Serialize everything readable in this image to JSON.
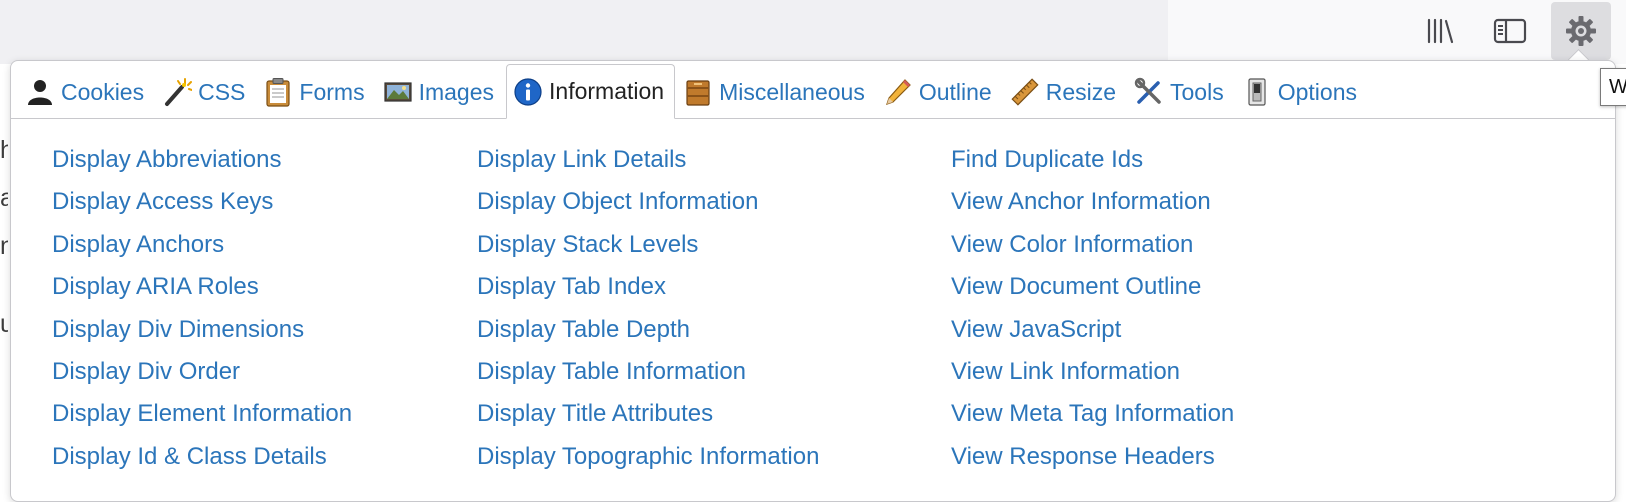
{
  "browser": {
    "tooltip_text": "W"
  },
  "background_letters": [
    "h",
    "a",
    "n",
    "u"
  ],
  "tabs": [
    {
      "label": "Cookies",
      "icon": "person-silhouette-icon"
    },
    {
      "label": "CSS",
      "icon": "magic-wand-icon"
    },
    {
      "label": "Forms",
      "icon": "clipboard-icon"
    },
    {
      "label": "Images",
      "icon": "picture-icon"
    },
    {
      "label": "Information",
      "icon": "info-icon",
      "active": true
    },
    {
      "label": "Miscellaneous",
      "icon": "box-icon"
    },
    {
      "label": "Outline",
      "icon": "pencil-icon"
    },
    {
      "label": "Resize",
      "icon": "ruler-icon"
    },
    {
      "label": "Tools",
      "icon": "wrench-screwdriver-icon"
    },
    {
      "label": "Options",
      "icon": "switch-icon"
    }
  ],
  "columns": [
    [
      "Display Abbreviations",
      "Display Access Keys",
      "Display Anchors",
      "Display ARIA Roles",
      "Display Div Dimensions",
      "Display Div Order",
      "Display Element Information",
      "Display Id & Class Details"
    ],
    [
      "Display Link Details",
      "Display Object Information",
      "Display Stack Levels",
      "Display Tab Index",
      "Display Table Depth",
      "Display Table Information",
      "Display Title Attributes",
      "Display Topographic Information"
    ],
    [
      "Find Duplicate Ids",
      "View Anchor Information",
      "View Color Information",
      "View Document Outline",
      "View JavaScript",
      "View Link Information",
      "View Meta Tag Information",
      "View Response Headers"
    ]
  ],
  "colors": {
    "link": "#2b75ba",
    "active_tab_text": "#222222",
    "border": "#c8c8cc"
  }
}
